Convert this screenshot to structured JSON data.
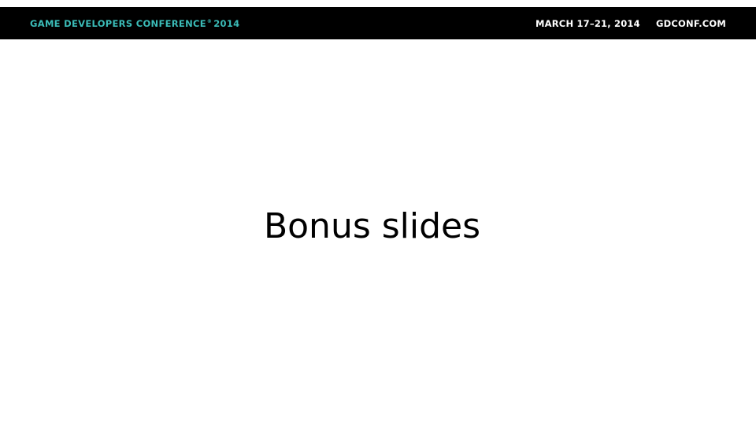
{
  "header": {
    "conference_name": "GAME DEVELOPERS CONFERENCE",
    "registered_mark": "®",
    "conference_year": "2014",
    "dates": "MARCH 17–21, 2014",
    "website": "GDCONF.COM",
    "bar_color": "#000000",
    "accent_color": "#3bbcb8"
  },
  "slide": {
    "title": "Bonus slides"
  }
}
